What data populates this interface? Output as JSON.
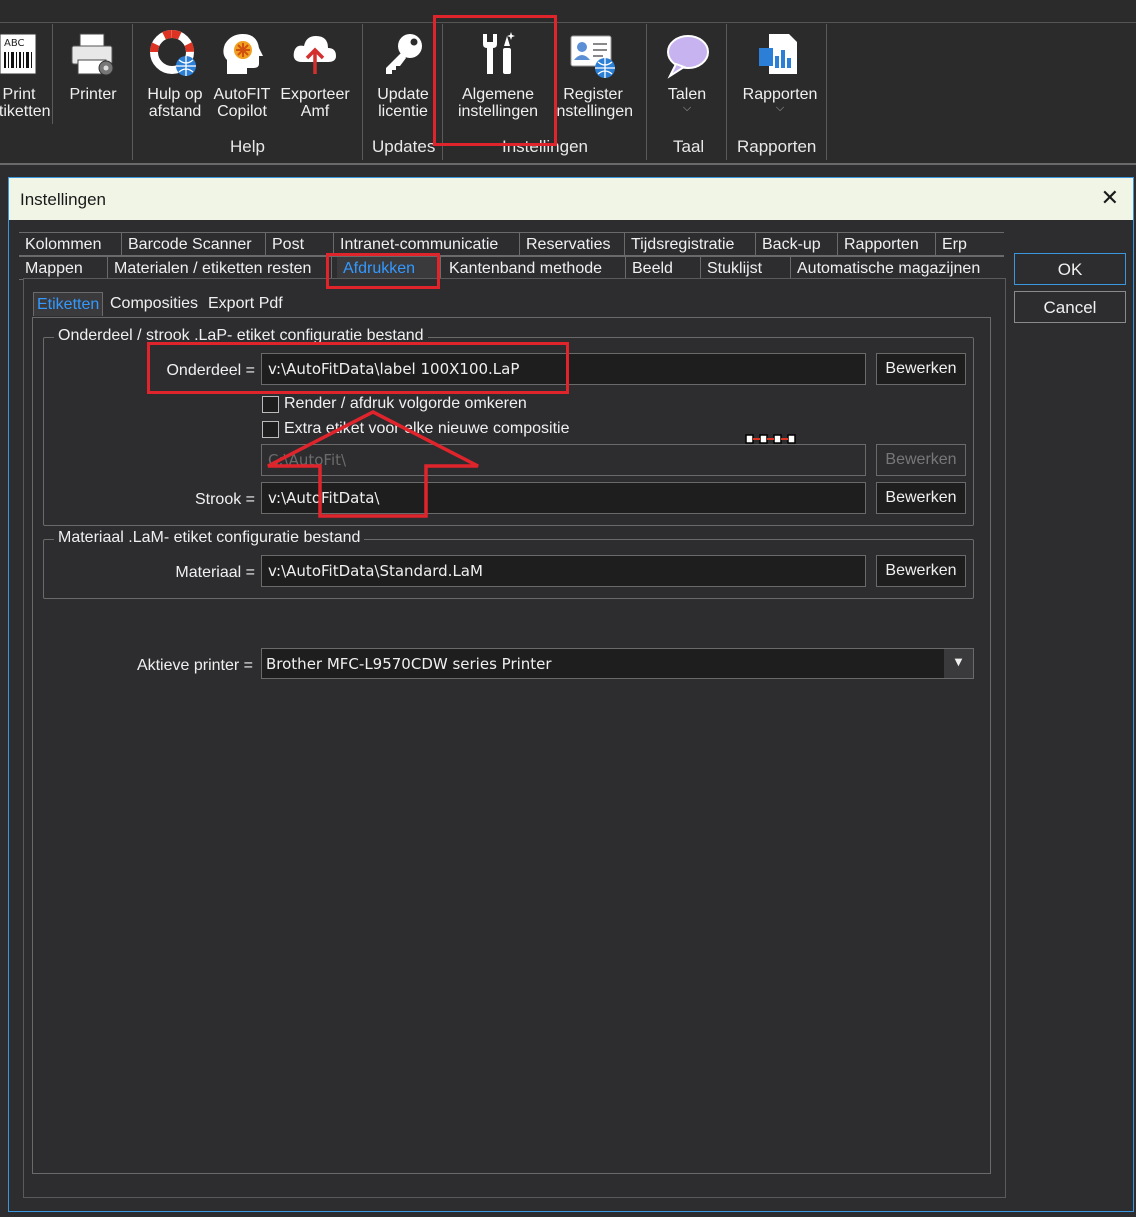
{
  "ribbon": {
    "buttons": {
      "print_labels": "Print\netiketten",
      "printer": "Printer",
      "remote_help": "Hulp op\nafstand",
      "copilot": "AutoFIT\nCopilot",
      "export_amf": "Exporteer\nAmf",
      "update_license": "Update\nlicentie",
      "general_settings": "Algemene\ninstellingen",
      "register_settings": "Register\ninstellingen",
      "languages": "Talen",
      "reports": "Rapporten"
    },
    "groups": {
      "help": "Help",
      "updates": "Updates",
      "settings": "Instellingen",
      "language": "Taal",
      "reports": "Rapporten"
    }
  },
  "dialog": {
    "title": "Instellingen",
    "close_glyph": "✕",
    "ok": "OK",
    "cancel": "Cancel",
    "tabs_row1": [
      "Kolommen",
      "Barcode Scanner",
      "Post",
      "Intranet-communicatie",
      "Reservaties",
      "Tijdsregistratie",
      "Back-up",
      "Rapporten",
      "Erp"
    ],
    "tabs_row2": [
      "Mappen",
      "Materialen / etiketten resten",
      "Afdrukken",
      "Kantenband methode",
      "Beeld",
      "Stuklijst",
      "Automatische magazijnen"
    ],
    "selected_tab": "Afdrukken",
    "subtabs": [
      "Etiketten",
      "Composities",
      "Export Pdf"
    ],
    "selected_subtab": "Etiketten",
    "part_group": {
      "title": "Onderdeel / strook .LaP- etiket configuratie bestand",
      "part_label": "Onderdeel =",
      "part_value": "v:\\AutoFitData\\label 100X100.LaP",
      "edit": "Bewerken",
      "render_reverse": "Render / afdruk volgorde omkeren",
      "extra_label": "Extra etiket voor elke nieuwe compositie",
      "extra_value": "C:\\AutoFit\\",
      "strip_label": "Strook =",
      "strip_value": "v:\\AutoFitData\\"
    },
    "material_group": {
      "title": "Materiaal .LaM- etiket configuratie bestand",
      "material_label": "Materiaal =",
      "material_value": "v:\\AutoFitData\\Standard.LaM",
      "edit": "Bewerken"
    },
    "printer_label": "Aktieve printer =",
    "printer_value": "Brother MFC-L9570CDW series Printer",
    "dropdown_glyph": "▼"
  }
}
